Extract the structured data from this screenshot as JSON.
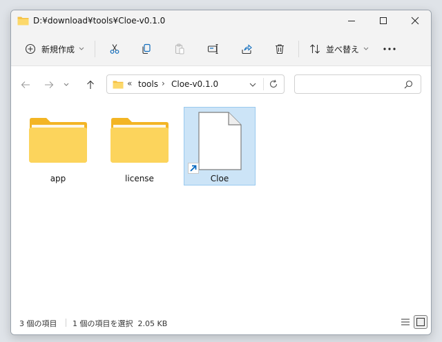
{
  "window": {
    "title": "D:¥download¥tools¥Cloe-v0.1.0",
    "controls": [
      "minimize-icon",
      "maximize-icon",
      "close-icon"
    ]
  },
  "toolbar": {
    "new_label": "新規作成",
    "sort_label": "並べ替え",
    "icons": [
      "plus-circle-icon",
      "cut-icon",
      "copy-icon",
      "paste-icon",
      "rename-icon",
      "share-icon",
      "delete-icon",
      "sort-icon",
      "more-icon"
    ]
  },
  "address": {
    "overflow": "«",
    "crumbs": [
      "tools",
      "Cloe-v0.1.0"
    ],
    "separator": "›"
  },
  "search": {
    "placeholder": ""
  },
  "items": [
    {
      "label": "app",
      "type": "folder",
      "selected": false
    },
    {
      "label": "license",
      "type": "folder",
      "selected": false
    },
    {
      "label": "Cloe",
      "type": "shortcut",
      "selected": true
    }
  ],
  "status": {
    "count": "3 個の項目",
    "selection": "1 個の項目を選択  2.05 KB"
  },
  "colors": {
    "selection_bg": "#cce4f7",
    "selection_border": "#99c9ef",
    "folder": "#f8c84a",
    "accent": "#0067c0"
  }
}
